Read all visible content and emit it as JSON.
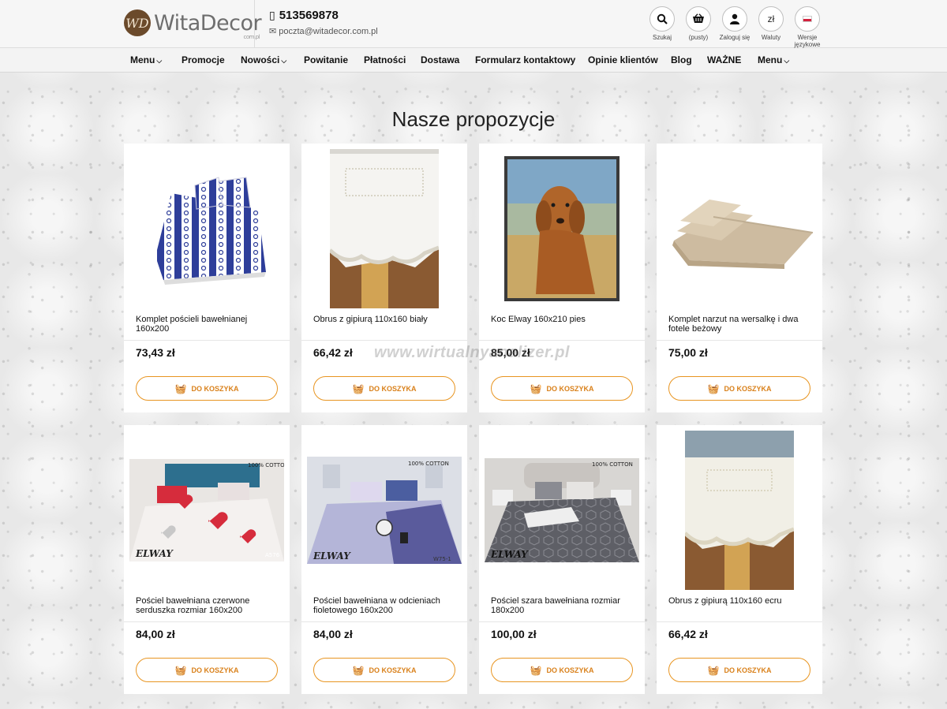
{
  "header": {
    "logo_text": "WitaDecor",
    "logo_mark": "WD",
    "logo_sub": "com.pl",
    "phone": "513569878",
    "email": "poczta@witadecor.com.pl",
    "icons": [
      {
        "name": "search-icon",
        "glyph": "🔍",
        "label": "Szukaj"
      },
      {
        "name": "basket-icon",
        "glyph": "🛒",
        "label": "(pusty)"
      },
      {
        "name": "user-icon",
        "glyph": "👤",
        "label": "Zaloguj się"
      },
      {
        "name": "currency-icon",
        "glyph": "zł",
        "label": "Waluty"
      },
      {
        "name": "flag-icon",
        "glyph": "",
        "label": "Wersje językowe"
      }
    ]
  },
  "nav": {
    "items": [
      {
        "label": "Menu",
        "dropdown": true
      },
      {
        "label": "Promocje",
        "dropdown": false
      },
      {
        "label": "Nowości",
        "dropdown": true
      },
      {
        "label": "Powitanie",
        "dropdown": false
      },
      {
        "label": "Płatności",
        "dropdown": false
      },
      {
        "label": "Dostawa",
        "dropdown": false
      },
      {
        "label": "Formularz kontaktowy",
        "dropdown": false
      },
      {
        "label": "Opinie klientów",
        "dropdown": false
      },
      {
        "label": "Blog",
        "dropdown": false
      },
      {
        "label": "WAŻNE",
        "dropdown": false
      },
      {
        "label": "Menu",
        "dropdown": true
      }
    ]
  },
  "section_title": "Nasze propozycje",
  "button_label": "DO KOSZYKA",
  "watermark": "www.wirtualnyanalizer.pl",
  "products": [
    {
      "name": "Komplet pościeli bawełnianej 160x200",
      "price": "73,43 zł",
      "image": "bedding-blue"
    },
    {
      "name": "Obrus z gipiurą 110x160 biały",
      "price": "66,42 zł",
      "image": "tablecloth-white"
    },
    {
      "name": "Koc Elway 160x210 pies",
      "price": "85,00 zł",
      "image": "blanket-dog"
    },
    {
      "name": "Komplet narzut na wersalkę i dwa fotele beżowy",
      "price": "75,00 zł",
      "image": "throws-beige"
    },
    {
      "name": "Pościel bawełniana czerwone serduszka rozmiar 160x200",
      "price": "84,00 zł",
      "image": "bedding-hearts"
    },
    {
      "name": "Pościel bawełniana w odcieniach fioletowego 160x200",
      "price": "84,00 zł",
      "image": "bedding-violet"
    },
    {
      "name": "Pościel szara bawełniana rozmiar 180x200",
      "price": "100,00 zł",
      "image": "bedding-grey"
    },
    {
      "name": "Obrus z gipiurą 110x160 ecru",
      "price": "66,42 zł",
      "image": "tablecloth-ecru"
    }
  ],
  "image_texts": {
    "cotton": "100% COTTON",
    "brand": "ELWAY",
    "code_hearts": "A576",
    "code_violet": "W75-1"
  }
}
